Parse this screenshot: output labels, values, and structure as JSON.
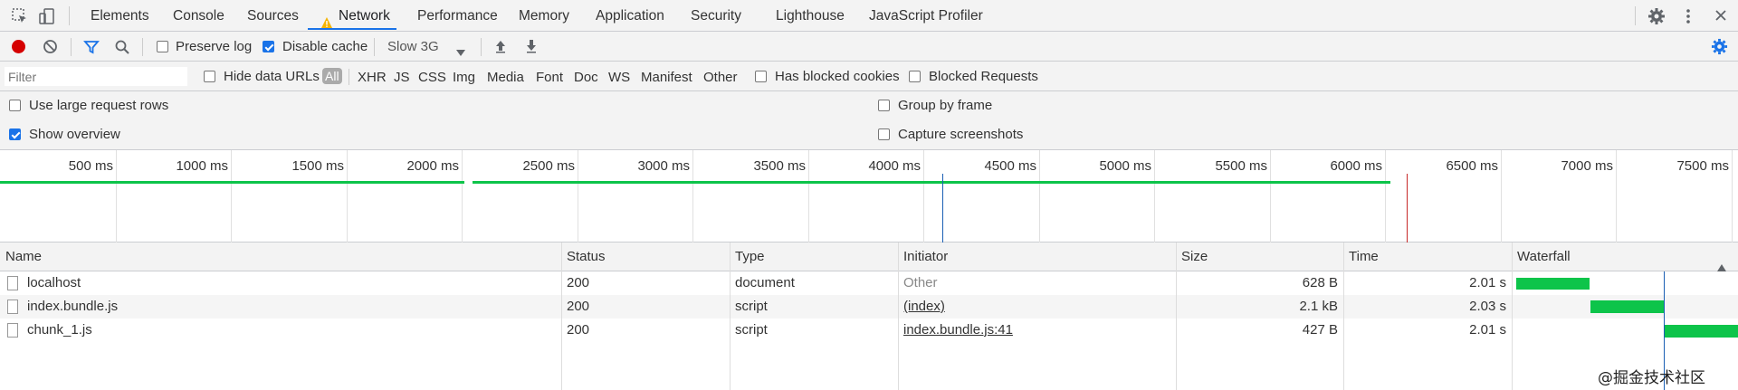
{
  "tabs": [
    {
      "label": "Elements"
    },
    {
      "label": "Console"
    },
    {
      "label": "Sources"
    },
    {
      "label": "Network"
    },
    {
      "label": "Performance"
    },
    {
      "label": "Memory"
    },
    {
      "label": "Application"
    },
    {
      "label": "Security"
    },
    {
      "label": "Lighthouse"
    },
    {
      "label": "JavaScript Profiler"
    }
  ],
  "toolbar": {
    "preserve_log": "Preserve log",
    "preserve_log_checked": false,
    "disable_cache": "Disable cache",
    "disable_cache_checked": true,
    "throttle": "Slow 3G"
  },
  "filterbar": {
    "filter_placeholder": "Filter",
    "hide_data_urls": "Hide data URLs",
    "types": [
      "All",
      "XHR",
      "JS",
      "CSS",
      "Img",
      "Media",
      "Font",
      "Doc",
      "WS",
      "Manifest",
      "Other"
    ],
    "has_blocked_cookies": "Has blocked cookies",
    "blocked_requests": "Blocked Requests"
  },
  "settings": {
    "large_rows": "Use large request rows",
    "show_overview": "Show overview",
    "show_overview_checked": true,
    "group_by_frame": "Group by frame",
    "capture_screenshots": "Capture screenshots"
  },
  "overview": {
    "ticks": [
      "500 ms",
      "1000 ms",
      "1500 ms",
      "2000 ms",
      "2500 ms",
      "3000 ms",
      "3500 ms",
      "4000 ms",
      "4500 ms",
      "5000 ms",
      "5500 ms",
      "6000 ms",
      "6500 ms",
      "7000 ms",
      "7500 ms"
    ]
  },
  "table": {
    "headers": {
      "name": "Name",
      "status": "Status",
      "type": "Type",
      "initiator": "Initiator",
      "size": "Size",
      "time": "Time",
      "waterfall": "Waterfall"
    },
    "rows": [
      {
        "name": "localhost",
        "status": "200",
        "type": "document",
        "initiator": "Other",
        "size": "628 B",
        "time": "2.01 s"
      },
      {
        "name": "index.bundle.js",
        "status": "200",
        "type": "script",
        "initiator": "(index)",
        "size": "2.1 kB",
        "time": "2.03 s"
      },
      {
        "name": "chunk_1.js",
        "status": "200",
        "type": "script",
        "initiator": "index.bundle.js:41",
        "size": "427 B",
        "time": "2.01 s"
      }
    ]
  },
  "watermark": "@掘金技术社区",
  "colors": {
    "accent": "#1a73e8",
    "bar": "#0dc44a",
    "record": "#d50000",
    "domcontent": "#1a5fb4",
    "load": "#c62828",
    "warning": "#f4b400"
  }
}
